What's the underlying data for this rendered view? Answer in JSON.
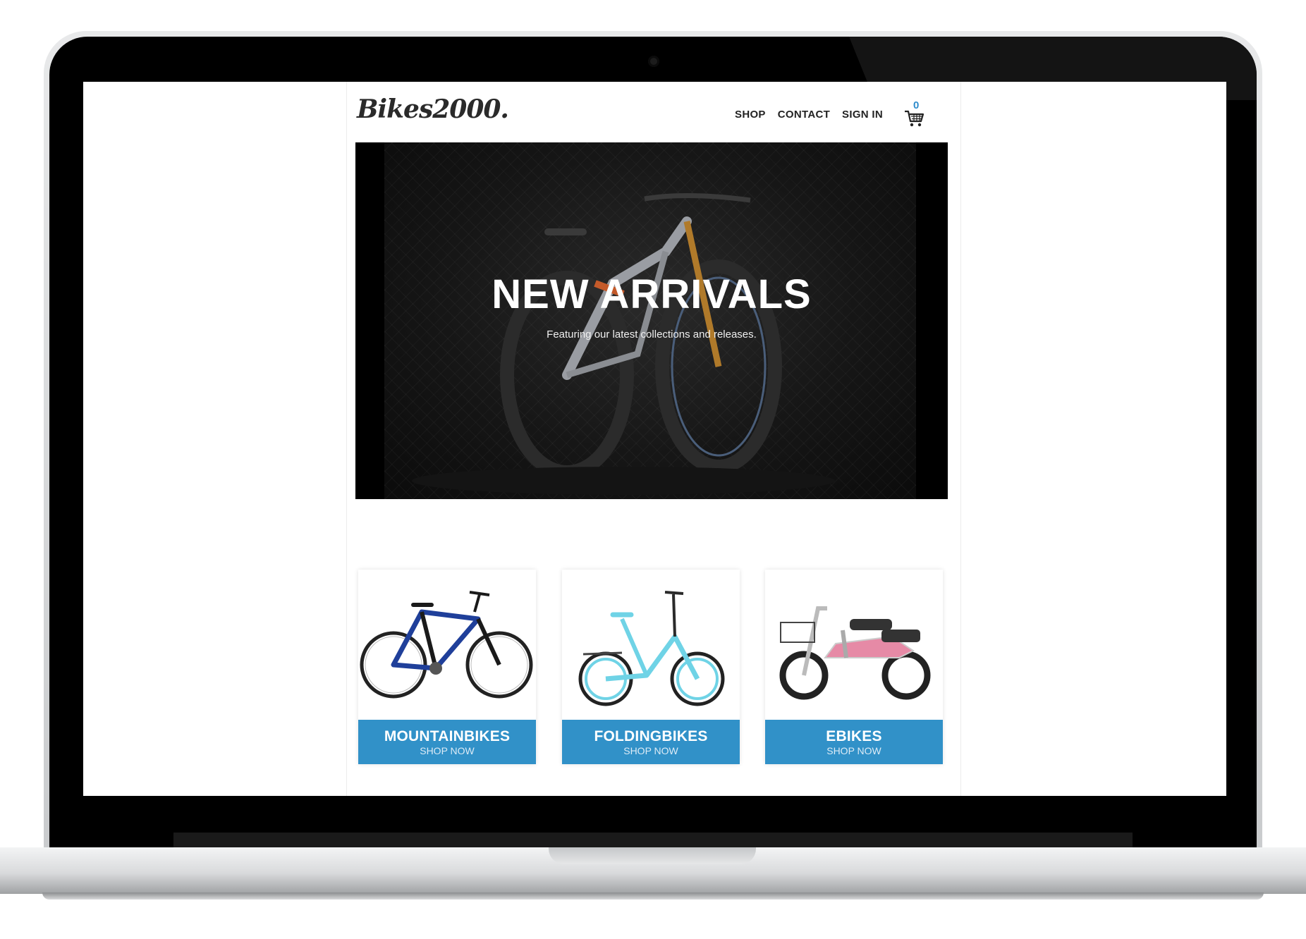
{
  "brand": {
    "logo": "Bikes2000."
  },
  "nav": {
    "items": [
      "SHOP",
      "CONTACT",
      "SIGN IN"
    ]
  },
  "cart": {
    "count": "0",
    "icon": "shopping-cart-icon"
  },
  "hero": {
    "title": "NEW ARRIVALS",
    "subtitle": "Featuring our latest collections and releases."
  },
  "categories": [
    {
      "name": "MOUNTAINBIKES",
      "cta": "SHOP NOW",
      "frame_color": "#1f3f9a"
    },
    {
      "name": "FOLDINGBIKES",
      "cta": "SHOP NOW",
      "frame_color": "#6fd3e6"
    },
    {
      "name": "EBIKES",
      "cta": "SHOP NOW",
      "frame_color": "#e68aa6"
    }
  ],
  "colors": {
    "accent": "#3191c8",
    "cart_count": "#2e8ccc"
  }
}
